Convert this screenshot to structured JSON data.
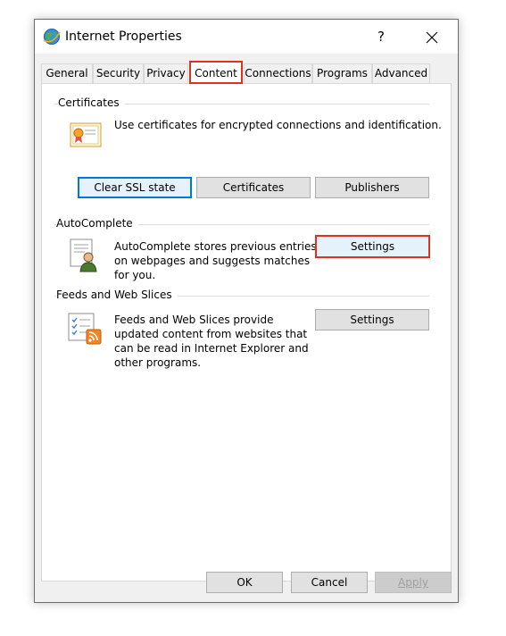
{
  "window": {
    "title": "Internet Properties",
    "help_label": "?"
  },
  "tabs": [
    {
      "label": "General"
    },
    {
      "label": "Security"
    },
    {
      "label": "Privacy"
    },
    {
      "label": "Content",
      "active": true
    },
    {
      "label": "Connections"
    },
    {
      "label": "Programs"
    },
    {
      "label": "Advanced"
    }
  ],
  "certificates": {
    "heading": "Certificates",
    "description": "Use certificates for encrypted connections and identification.",
    "clear_ssl_label": "Clear SSL state",
    "certificates_label": "Certificates",
    "publishers_label": "Publishers"
  },
  "autocomplete": {
    "heading": "AutoComplete",
    "line1": "AutoComplete stores previous entries",
    "line2": "on webpages and suggests matches",
    "line3": "for you.",
    "settings_label": "Settings"
  },
  "feeds": {
    "heading": "Feeds and Web Slices",
    "line1": "Feeds and Web Slices provide",
    "line2": "updated content from websites that",
    "line3": "can be read in Internet Explorer and",
    "line4": "other programs.",
    "settings_label": "Settings"
  },
  "footer": {
    "ok_label": "OK",
    "cancel_label": "Cancel",
    "apply_label": "Apply"
  },
  "colors": {
    "highlight": "#e0301e",
    "focus": "#0078d7"
  }
}
